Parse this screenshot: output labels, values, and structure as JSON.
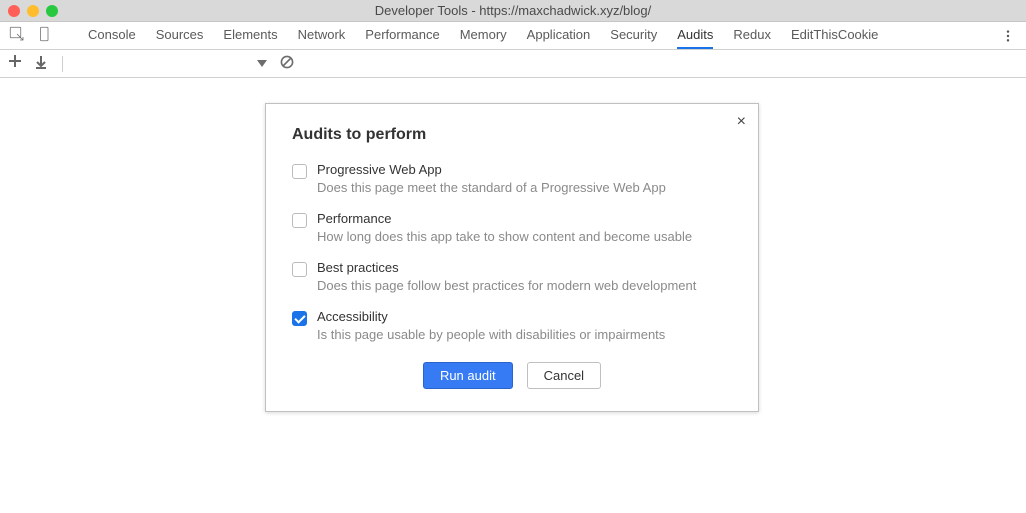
{
  "window": {
    "title": "Developer Tools - https://maxchadwick.xyz/blog/"
  },
  "tabs": {
    "items": [
      {
        "label": "Console"
      },
      {
        "label": "Sources"
      },
      {
        "label": "Elements"
      },
      {
        "label": "Network"
      },
      {
        "label": "Performance"
      },
      {
        "label": "Memory"
      },
      {
        "label": "Application"
      },
      {
        "label": "Security"
      },
      {
        "label": "Audits"
      },
      {
        "label": "Redux"
      },
      {
        "label": "EditThisCookie"
      }
    ],
    "active_index": 8
  },
  "dialog": {
    "title": "Audits to perform",
    "close_glyph": "×",
    "buttons": {
      "primary": "Run audit",
      "secondary": "Cancel"
    },
    "audits": [
      {
        "checked": false,
        "label": "Progressive Web App",
        "desc": "Does this page meet the standard of a Progressive Web App"
      },
      {
        "checked": false,
        "label": "Performance",
        "desc": "How long does this app take to show content and become usable"
      },
      {
        "checked": false,
        "label": "Best practices",
        "desc": "Does this page follow best practices for modern web development"
      },
      {
        "checked": true,
        "label": "Accessibility",
        "desc": "Is this page usable by people with disabilities or impairments"
      }
    ]
  },
  "icons": {
    "plus": "＋",
    "download": "↓"
  }
}
